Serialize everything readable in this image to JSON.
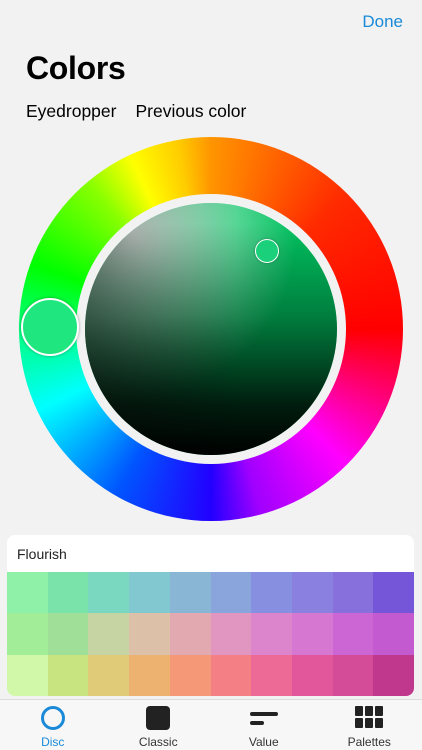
{
  "header": {
    "done_label": "Done",
    "title": "Colors"
  },
  "quick_actions": {
    "eyedropper_label": "Eyedropper",
    "previous_color_label": "Previous color"
  },
  "color_picker": {
    "selected_hue_color": "#1fe67e",
    "selected_color": "#1bd07a",
    "accent": "#1a8ad8"
  },
  "palette": {
    "name": "Flourish",
    "swatches": [
      [
        "#8ff0a8",
        "#7ae3aa",
        "#7bd8c0",
        "#82c8d0",
        "#8ab6d6",
        "#8aa4dc",
        "#8790e0",
        "#8a80e0",
        "#8770dc",
        "#7555d8"
      ],
      [
        "#a2ee98",
        "#a0df98",
        "#c6d3a2",
        "#dcc0a8",
        "#e2aab0",
        "#e096c0",
        "#dc84cc",
        "#d677d2",
        "#cc66d4",
        "#c45ad0"
      ],
      [
        "#d0f8a8",
        "#c8e480",
        "#e0cc78",
        "#eeb270",
        "#f49878",
        "#f48086",
        "#ee6a96",
        "#e2579c",
        "#d44c98",
        "#c0388e"
      ]
    ]
  },
  "tabs": [
    {
      "label": "Disc",
      "icon": "disc-icon",
      "active": true
    },
    {
      "label": "Classic",
      "icon": "classic-square-icon",
      "active": false
    },
    {
      "label": "Value",
      "icon": "value-bars-icon",
      "active": false
    },
    {
      "label": "Palettes",
      "icon": "palettes-grid-icon",
      "active": false
    }
  ]
}
